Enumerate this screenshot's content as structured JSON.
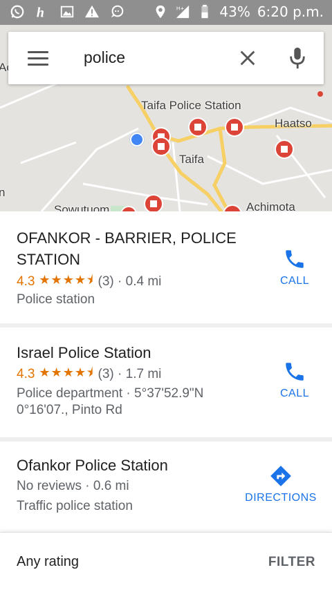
{
  "status_bar": {
    "battery": "43%",
    "time": "6:20 p.m.",
    "icons": [
      "whatsapp-icon",
      "h-app-icon",
      "image-icon",
      "warning-icon",
      "chat-icon",
      "location-icon",
      "signal-icon",
      "battery-icon"
    ]
  },
  "search": {
    "query": "police"
  },
  "map": {
    "labels": {
      "taifa_police": "Taifa Police Station",
      "haatso": "Haatso",
      "taifa": "Taifa",
      "sowutuom": "Sowutuom",
      "achimota": "Achimota",
      "edge_left_top": "Ac",
      "edge_left_bottom": "n"
    }
  },
  "results": [
    {
      "title": "OFANKOR - BARRIER, POLICE STATION",
      "rating": "4.3",
      "stars": "★★★★⯨",
      "count_distance": "(3) · 0.4 mi",
      "type": "Police station",
      "action": "CALL"
    },
    {
      "title": "Israel Police Station",
      "rating": "4.3",
      "stars": "★★★★⯨",
      "count_distance": "(3) · 1.7 mi",
      "detail_line1": "Police department · 5°37'52.9\"N",
      "detail_line2": "0°16'07., Pinto Rd",
      "action": "CALL"
    },
    {
      "title": "Ofankor Police Station",
      "reviews_distance": "No reviews · 0.6 mi",
      "type": "Traffic police station",
      "action": "DIRECTIONS"
    }
  ],
  "filter_bar": {
    "any_rating": "Any rating",
    "filter": "FILTER"
  },
  "colors": {
    "accent": "#1a73e8",
    "rating": "#e37400",
    "road": "#f6cf65",
    "marker": "#db4437",
    "my_location": "#4285f4"
  }
}
